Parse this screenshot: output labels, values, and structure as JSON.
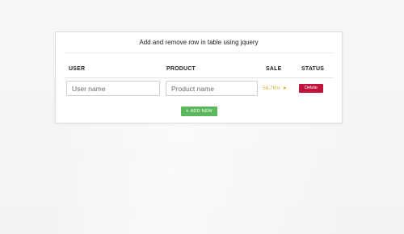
{
  "card": {
    "title": "Add and remove row in table using jquery"
  },
  "table": {
    "columns": [
      "USER",
      "PRODUCT",
      "SALE",
      "STATUS"
    ],
    "row": {
      "user_placeholder": "User name",
      "product_placeholder": "Product name",
      "sale_text": "56.76%",
      "sale_icon": "arrow-icon",
      "status_button": "Delete"
    }
  },
  "actions": {
    "add_new_label": "ADD NEW",
    "add_icon": "plus-icon"
  },
  "colors": {
    "delete": "#c0143c",
    "add": "#5cb85c",
    "sale": "#d4b03a"
  }
}
